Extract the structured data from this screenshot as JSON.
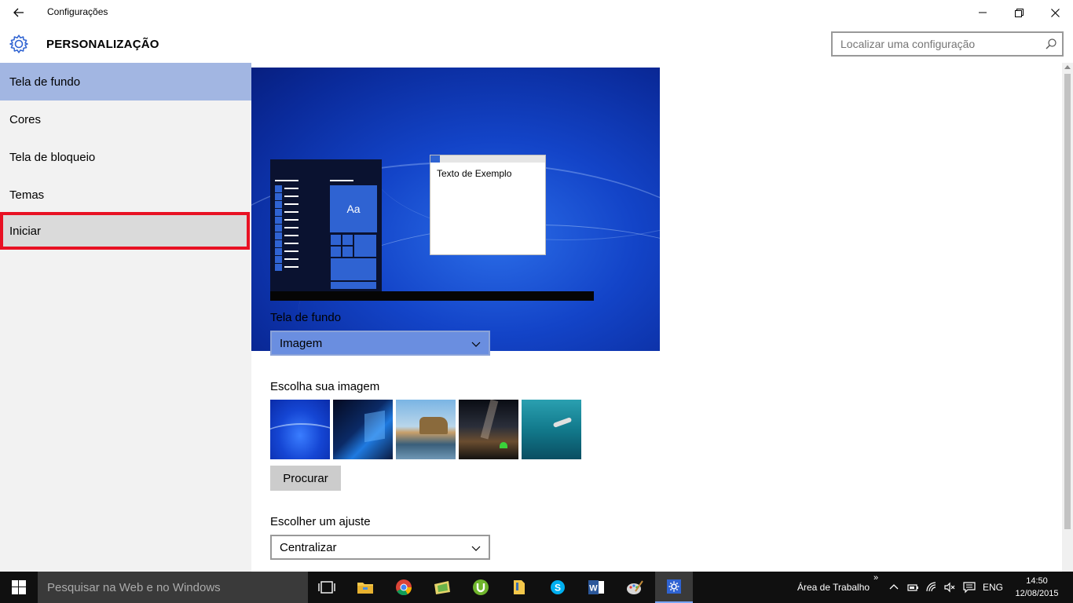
{
  "window": {
    "title": "Configurações",
    "controls": {
      "minimize": "—",
      "maximize": "❐",
      "close": "✕"
    }
  },
  "header": {
    "section_title": "PERSONALIZAÇÃO",
    "search_placeholder": "Localizar uma configuração"
  },
  "sidebar": {
    "items": [
      {
        "label": "Tela de fundo",
        "state": "selected"
      },
      {
        "label": "Cores",
        "state": "normal"
      },
      {
        "label": "Tela de bloqueio",
        "state": "normal"
      },
      {
        "label": "Temas",
        "state": "normal"
      },
      {
        "label": "Iniciar",
        "state": "highlighted"
      }
    ]
  },
  "preview": {
    "sample_text": "Texto de Exemplo",
    "tile_label": "Aa"
  },
  "background": {
    "label": "Tela de fundo",
    "selected": "Imagem"
  },
  "choose_image": {
    "label": "Escolha sua imagem",
    "thumbnails": [
      "windows-blue-wallpaper",
      "windows-10-logo-wallpaper",
      "beach-rock-wallpaper",
      "night-sky-tent-wallpaper",
      "underwater-swimmer-wallpaper"
    ],
    "browse_label": "Procurar"
  },
  "fit": {
    "label": "Escolher um ajuste",
    "selected": "Centralizar"
  },
  "taskbar": {
    "search_placeholder": "Pesquisar na Web e no Windows",
    "apps": [
      "task-view",
      "file-explorer",
      "chrome",
      "photos",
      "utorrent",
      "folder",
      "skype",
      "word",
      "paint",
      "settings"
    ],
    "desktop_label": "Área de Trabalho",
    "language": "ENG",
    "time": "14:50",
    "date": "12/08/2015"
  },
  "colors": {
    "accent": "#2f63d2",
    "selected_nav": "#a2b6e2",
    "highlight_border": "#e81123"
  }
}
